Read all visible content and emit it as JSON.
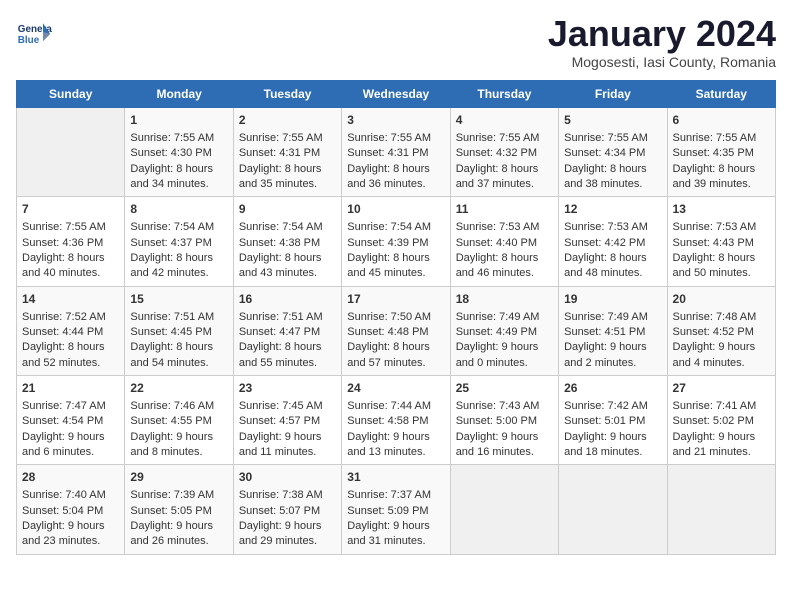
{
  "header": {
    "logo_general": "General",
    "logo_blue": "Blue",
    "month_title": "January 2024",
    "location": "Mogosesti, Iasi County, Romania"
  },
  "days_of_week": [
    "Sunday",
    "Monday",
    "Tuesday",
    "Wednesday",
    "Thursday",
    "Friday",
    "Saturday"
  ],
  "weeks": [
    [
      {
        "day": "",
        "data": ""
      },
      {
        "day": "1",
        "data": "Sunrise: 7:55 AM\nSunset: 4:30 PM\nDaylight: 8 hours\nand 34 minutes."
      },
      {
        "day": "2",
        "data": "Sunrise: 7:55 AM\nSunset: 4:31 PM\nDaylight: 8 hours\nand 35 minutes."
      },
      {
        "day": "3",
        "data": "Sunrise: 7:55 AM\nSunset: 4:31 PM\nDaylight: 8 hours\nand 36 minutes."
      },
      {
        "day": "4",
        "data": "Sunrise: 7:55 AM\nSunset: 4:32 PM\nDaylight: 8 hours\nand 37 minutes."
      },
      {
        "day": "5",
        "data": "Sunrise: 7:55 AM\nSunset: 4:34 PM\nDaylight: 8 hours\nand 38 minutes."
      },
      {
        "day": "6",
        "data": "Sunrise: 7:55 AM\nSunset: 4:35 PM\nDaylight: 8 hours\nand 39 minutes."
      }
    ],
    [
      {
        "day": "7",
        "data": "Sunrise: 7:55 AM\nSunset: 4:36 PM\nDaylight: 8 hours\nand 40 minutes."
      },
      {
        "day": "8",
        "data": "Sunrise: 7:54 AM\nSunset: 4:37 PM\nDaylight: 8 hours\nand 42 minutes."
      },
      {
        "day": "9",
        "data": "Sunrise: 7:54 AM\nSunset: 4:38 PM\nDaylight: 8 hours\nand 43 minutes."
      },
      {
        "day": "10",
        "data": "Sunrise: 7:54 AM\nSunset: 4:39 PM\nDaylight: 8 hours\nand 45 minutes."
      },
      {
        "day": "11",
        "data": "Sunrise: 7:53 AM\nSunset: 4:40 PM\nDaylight: 8 hours\nand 46 minutes."
      },
      {
        "day": "12",
        "data": "Sunrise: 7:53 AM\nSunset: 4:42 PM\nDaylight: 8 hours\nand 48 minutes."
      },
      {
        "day": "13",
        "data": "Sunrise: 7:53 AM\nSunset: 4:43 PM\nDaylight: 8 hours\nand 50 minutes."
      }
    ],
    [
      {
        "day": "14",
        "data": "Sunrise: 7:52 AM\nSunset: 4:44 PM\nDaylight: 8 hours\nand 52 minutes."
      },
      {
        "day": "15",
        "data": "Sunrise: 7:51 AM\nSunset: 4:45 PM\nDaylight: 8 hours\nand 54 minutes."
      },
      {
        "day": "16",
        "data": "Sunrise: 7:51 AM\nSunset: 4:47 PM\nDaylight: 8 hours\nand 55 minutes."
      },
      {
        "day": "17",
        "data": "Sunrise: 7:50 AM\nSunset: 4:48 PM\nDaylight: 8 hours\nand 57 minutes."
      },
      {
        "day": "18",
        "data": "Sunrise: 7:49 AM\nSunset: 4:49 PM\nDaylight: 9 hours\nand 0 minutes."
      },
      {
        "day": "19",
        "data": "Sunrise: 7:49 AM\nSunset: 4:51 PM\nDaylight: 9 hours\nand 2 minutes."
      },
      {
        "day": "20",
        "data": "Sunrise: 7:48 AM\nSunset: 4:52 PM\nDaylight: 9 hours\nand 4 minutes."
      }
    ],
    [
      {
        "day": "21",
        "data": "Sunrise: 7:47 AM\nSunset: 4:54 PM\nDaylight: 9 hours\nand 6 minutes."
      },
      {
        "day": "22",
        "data": "Sunrise: 7:46 AM\nSunset: 4:55 PM\nDaylight: 9 hours\nand 8 minutes."
      },
      {
        "day": "23",
        "data": "Sunrise: 7:45 AM\nSunset: 4:57 PM\nDaylight: 9 hours\nand 11 minutes."
      },
      {
        "day": "24",
        "data": "Sunrise: 7:44 AM\nSunset: 4:58 PM\nDaylight: 9 hours\nand 13 minutes."
      },
      {
        "day": "25",
        "data": "Sunrise: 7:43 AM\nSunset: 5:00 PM\nDaylight: 9 hours\nand 16 minutes."
      },
      {
        "day": "26",
        "data": "Sunrise: 7:42 AM\nSunset: 5:01 PM\nDaylight: 9 hours\nand 18 minutes."
      },
      {
        "day": "27",
        "data": "Sunrise: 7:41 AM\nSunset: 5:02 PM\nDaylight: 9 hours\nand 21 minutes."
      }
    ],
    [
      {
        "day": "28",
        "data": "Sunrise: 7:40 AM\nSunset: 5:04 PM\nDaylight: 9 hours\nand 23 minutes."
      },
      {
        "day": "29",
        "data": "Sunrise: 7:39 AM\nSunset: 5:05 PM\nDaylight: 9 hours\nand 26 minutes."
      },
      {
        "day": "30",
        "data": "Sunrise: 7:38 AM\nSunset: 5:07 PM\nDaylight: 9 hours\nand 29 minutes."
      },
      {
        "day": "31",
        "data": "Sunrise: 7:37 AM\nSunset: 5:09 PM\nDaylight: 9 hours\nand 31 minutes."
      },
      {
        "day": "",
        "data": ""
      },
      {
        "day": "",
        "data": ""
      },
      {
        "day": "",
        "data": ""
      }
    ]
  ]
}
